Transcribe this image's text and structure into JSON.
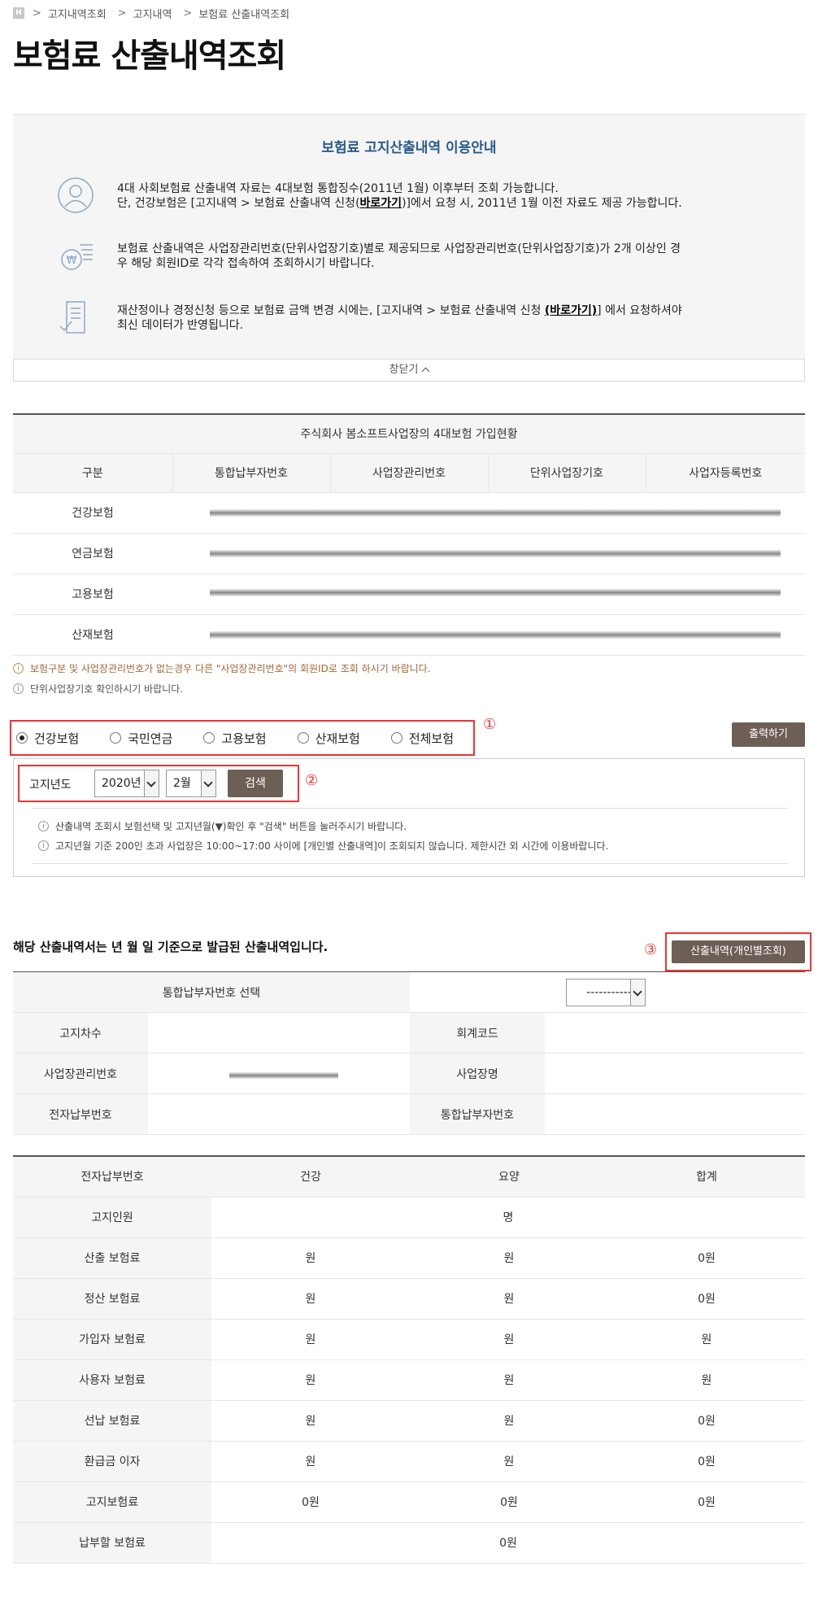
{
  "breadcrumb": {
    "home_label": "H",
    "items": [
      "고지내역조회",
      "고지내역",
      "보험료 산출내역조회"
    ]
  },
  "page": {
    "title": "보험료 산출내역조회"
  },
  "guide": {
    "title": "보험료 고지산출내역 이용안내",
    "items": [
      {
        "icon": "person-icon",
        "line1": "4대 사회보험료 산출내역 자료는 4대보험 통합징수(2011년 1월) 이후부터 조회 가능합니다.",
        "line2a": "단, 건강보험은 [고지내역 > 보험료 산출내역 신청(",
        "link": "바로가기",
        "line2b": ")]에서 요청 시, 2011년 1월 이전 자료도 제공 가능합니다."
      },
      {
        "icon": "coins-icon",
        "line1": "보험료 산출내역은 사업장관리번호(단위사업장기호)별로 제공되므로 사업장관리번호(단위사업장기호)가 2개 이상인 경",
        "line2": "우 해당 회원ID로 각각 접속하여 조회하시기 바랍니다."
      },
      {
        "icon": "document-check-icon",
        "line1a": "재산정이나 경정신청 등으로 보험료 금액 변경 시에는, [고지내역 > 보험료 산출내역 신청 ",
        "link": "(바로가기)",
        "line1b": "] 에서 요청하셔야",
        "line2": "최신 데이터가 반영됩니다."
      }
    ],
    "close_label": "창닫기"
  },
  "enroll_table": {
    "caption": "주식회사 봄소프트사업장의 4대보험 가입현황",
    "headers": [
      "구분",
      "통합납부자번호",
      "사업장관리번호",
      "단위사업장기호",
      "사업자등록번호"
    ],
    "rows": [
      "건강보험",
      "연금보험",
      "고용보험",
      "산재보험"
    ]
  },
  "notes": [
    "보험구분 및 사업장관리번호가 없는경우 다른 \"사업장관리번호\"의 회원ID로 조회 하시기 바랍니다.",
    "단위사업장기호 확인하시기 바랍니다."
  ],
  "insurance_radios": {
    "options": [
      "건강보험",
      "국민연금",
      "고용보험",
      "산재보험",
      "전체보험"
    ],
    "selected": "건강보험",
    "marker": "①"
  },
  "print_button": "출력하기",
  "search": {
    "label": "고지년도",
    "year": "2020년",
    "month": "2월",
    "button": "검색",
    "marker": "②",
    "notes": [
      "산출내역 조회시 보험선택 및 고지년월(▼)확인 후 \"검색\" 버튼을 눌러주시기 바랍니다.",
      "고지년월 기준 200인 초과 사업장은 10:00~17:00 사이에 [개인별 산출내역]이 조회되지 않습니다. 제한시간 외 시간에 이용바랍니다."
    ]
  },
  "result": {
    "heading": "해당 산출내역서는 년 월 일 기준으로 발급된 산출내역입니다.",
    "marker": "③",
    "personal_button": "산출내역(개인별조회)",
    "select_label": "통합납부자번호 선택",
    "select_value": "-----------",
    "fields": [
      {
        "label1": "고지차수",
        "label2": "회계코드"
      },
      {
        "label1": "사업장관리번호",
        "label2": "사업장명"
      },
      {
        "label1": "전자납부번호",
        "label2": "통합납부자번호"
      }
    ]
  },
  "calc_table": {
    "headers": [
      "전자납부번호",
      "건강",
      "요양",
      "합계"
    ],
    "notice_row": {
      "label": "고지인원",
      "value": "명"
    },
    "rows": [
      {
        "label": "산출 보험료",
        "v": [
          "원",
          "원",
          "0원"
        ]
      },
      {
        "label": "정산 보험료",
        "v": [
          "원",
          "원",
          "0원"
        ]
      },
      {
        "label": "가입자 보험료",
        "v": [
          "원",
          "원",
          "원"
        ]
      },
      {
        "label": "사용자 보험료",
        "v": [
          "원",
          "원",
          "원"
        ]
      },
      {
        "label": "선납 보험료",
        "v": [
          "원",
          "원",
          "0원"
        ]
      },
      {
        "label": "환급금 이자",
        "v": [
          "원",
          "원",
          "0원"
        ]
      },
      {
        "label": "고지보험료",
        "v": [
          "0원",
          "0원",
          "0원"
        ]
      }
    ],
    "total_row": {
      "label": "납부할 보험료",
      "value": "0원"
    }
  }
}
